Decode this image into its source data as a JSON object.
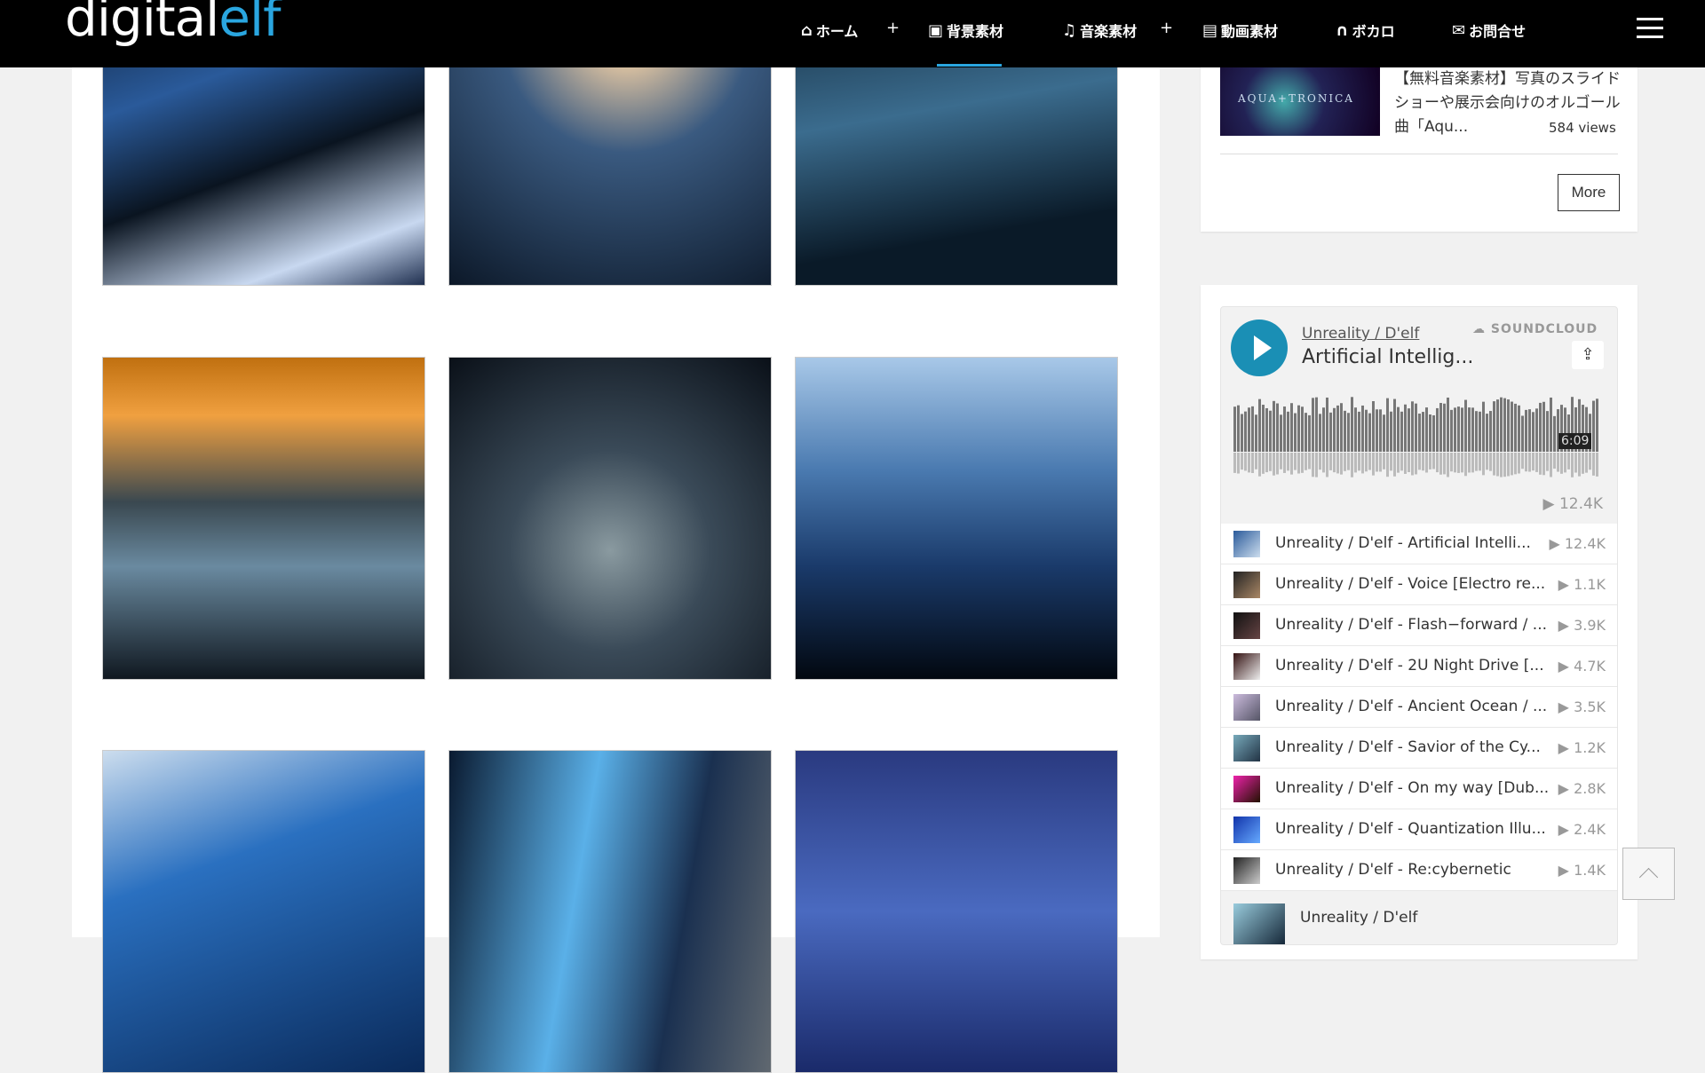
{
  "header": {
    "logo_main": "digital",
    "logo_accent": "elf",
    "nav": [
      {
        "label": "ホーム",
        "icon": "home-icon",
        "plus": true
      },
      {
        "label": "背景素材",
        "icon": "image-icon",
        "plus": false,
        "active": true
      },
      {
        "label": "音楽素材",
        "icon": "music-note-icon",
        "plus": true
      },
      {
        "label": "動画素材",
        "icon": "film-icon",
        "plus": false
      },
      {
        "label": "ボカロ",
        "icon": "headphones-icon",
        "plus": false
      },
      {
        "label": "お問合せ",
        "icon": "mail-icon",
        "plus": false
      }
    ],
    "plus_symbol": "+",
    "accent": "#2aa6e0"
  },
  "popular": {
    "thumb_text": "AQUA+TRONICA",
    "title": "【無料音楽素材】写真のスライドショーや展示会向けのオルゴール曲「Aqu...",
    "views": "584 views",
    "more": "More"
  },
  "soundcloud": {
    "artist": "Unreality / D'elf",
    "track": "Artificial Intellig...",
    "brand": "SOUNDCLOUD",
    "duration": "6:09",
    "plays": "▶ 12.4K",
    "play_color": "#1a8fb5",
    "tracks": [
      {
        "title": "Unreality / D'elf - Artificial Intelli...",
        "plays": "▶ 12.4K"
      },
      {
        "title": "Unreality / D'elf - Voice [Electro re...",
        "plays": "▶ 1.1K"
      },
      {
        "title": "Unreality / D'elf - Flash−forward / ...",
        "plays": "▶ 3.9K"
      },
      {
        "title": "Unreality / D'elf - 2U Night Drive [...",
        "plays": "▶ 4.7K"
      },
      {
        "title": "Unreality / D'elf - Ancient Ocean / ...",
        "plays": "▶ 3.5K"
      },
      {
        "title": "Unreality / D'elf - Savior of the Cy...",
        "plays": "▶ 1.2K"
      },
      {
        "title": "Unreality / D'elf - On my way [Dub...",
        "plays": "▶ 2.8K"
      },
      {
        "title": "Unreality / D'elf - Quantization Illu...",
        "plays": "▶ 2.4K"
      },
      {
        "title": "Unreality / D'elf - Re:cybernetic",
        "plays": "▶ 1.4K"
      }
    ],
    "footer_artist": "Unreality / D'elf"
  }
}
